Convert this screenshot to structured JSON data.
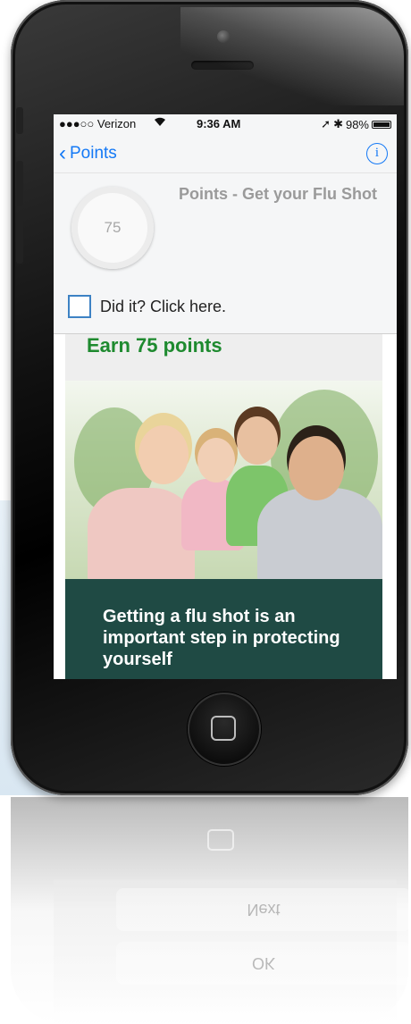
{
  "status_bar": {
    "carrier": "●●●○○ Verizon",
    "wifi_icon": "wifi-icon",
    "time": "9:36 AM",
    "location_icon": "➚",
    "bluetooth_icon": "✱",
    "battery": "98%"
  },
  "nav": {
    "back_label": "Points",
    "back_icon": "‹",
    "info_icon": "i"
  },
  "task": {
    "points": "75",
    "title": "Points - Get your Flu Shot",
    "checkbox_label": "Did it?  Click here."
  },
  "content": {
    "earn_text": "Earn 75 points",
    "promo_text": "Getting a flu shot is an important step in protecting yourself"
  },
  "reflection": {
    "buttons": [
      "Next",
      "OK"
    ]
  },
  "colors": {
    "accent_blue": "#1479f6",
    "earn_green": "#1e8a2f",
    "promo_bg": "#1f4a44"
  }
}
